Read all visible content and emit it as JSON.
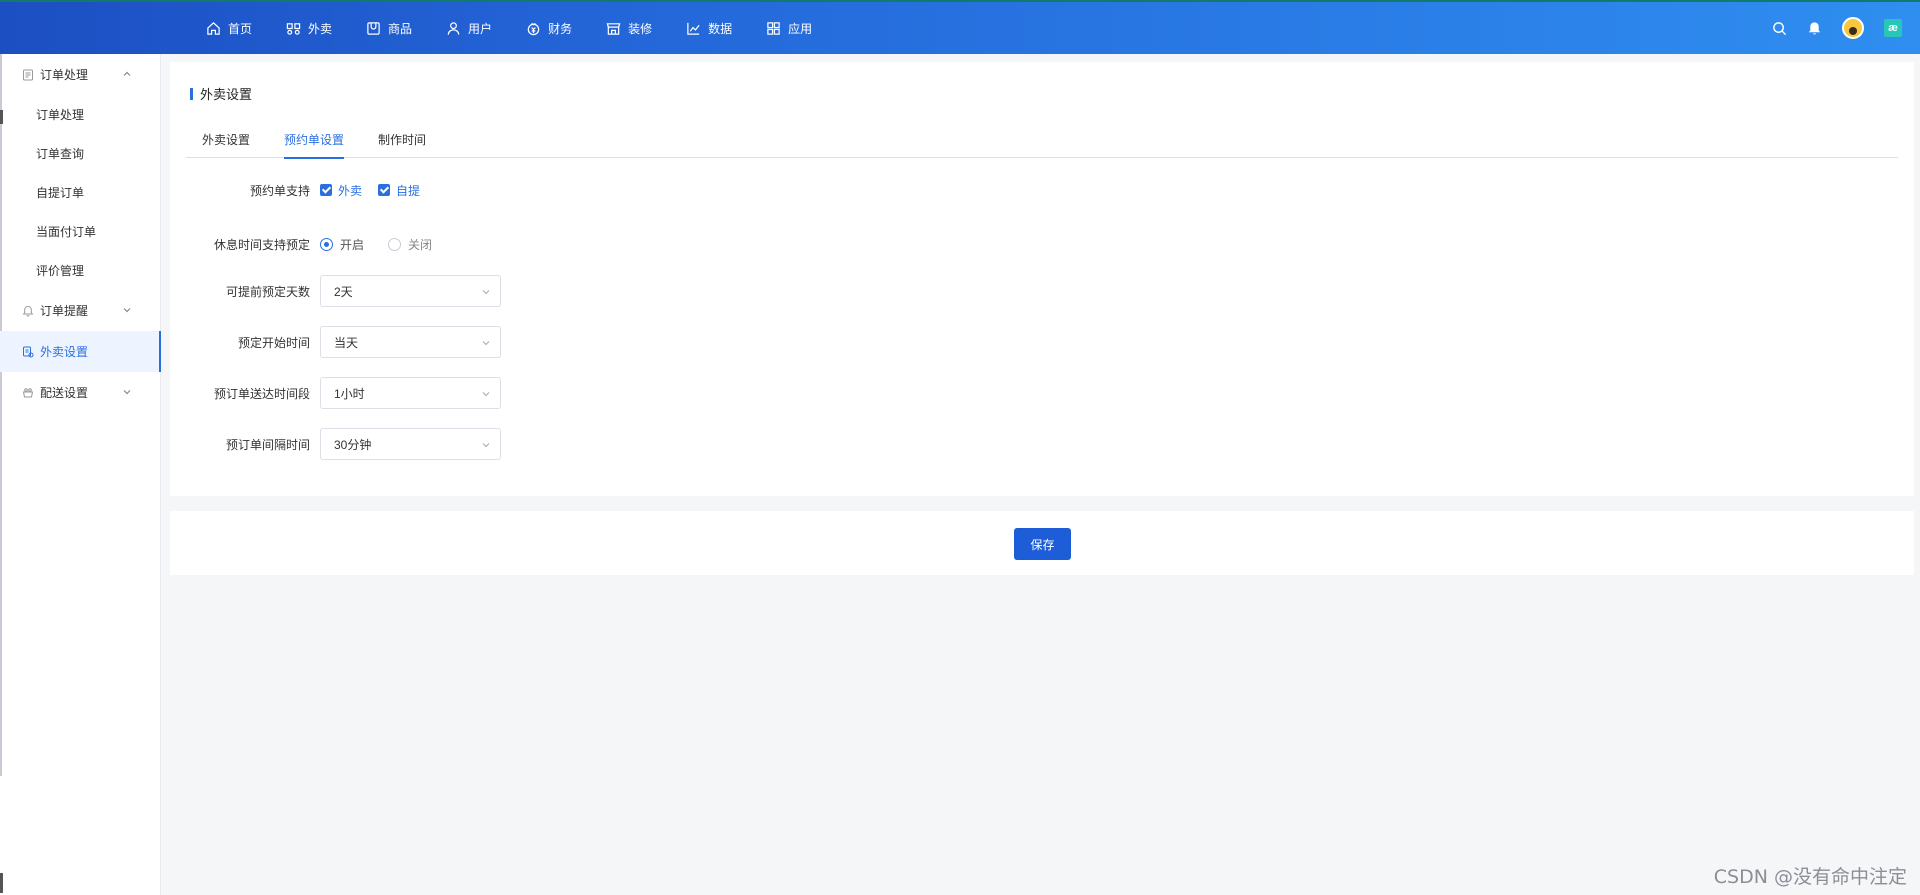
{
  "topnav": {
    "items": [
      {
        "label": "首页",
        "icon": "home-icon"
      },
      {
        "label": "外卖",
        "icon": "delivery-icon"
      },
      {
        "label": "商品",
        "icon": "goods-icon"
      },
      {
        "label": "用户",
        "icon": "user-icon"
      },
      {
        "label": "财务",
        "icon": "finance-icon"
      },
      {
        "label": "装修",
        "icon": "store-icon"
      },
      {
        "label": "数据",
        "icon": "chart-icon"
      },
      {
        "label": "应用",
        "icon": "apps-icon"
      }
    ],
    "app_badge": "æ"
  },
  "sidebar": {
    "order_group": {
      "label": "订单处理",
      "icon": "order-icon"
    },
    "order_items": [
      "订单处理",
      "订单查询",
      "自提订单",
      "当面付订单",
      "评价管理"
    ],
    "reminder_group": {
      "label": "订单提醒",
      "icon": "bell-icon"
    },
    "delivery_settings_group": {
      "label": "外卖设置",
      "icon": "settings-doc-icon"
    },
    "dispatch_group": {
      "label": "配送设置",
      "icon": "dispatch-icon"
    }
  },
  "main": {
    "title": "外卖设置",
    "tabs": [
      "外卖设置",
      "预约单设置",
      "制作时间"
    ],
    "active_tab": 1,
    "form": {
      "support_label": "预约单支持",
      "support_options": [
        "外卖",
        "自提"
      ],
      "rest_label": "休息时间支持预定",
      "rest_on": "开启",
      "rest_off": "关闭",
      "advance_days_label": "可提前预定天数",
      "advance_days_value": "2天",
      "start_time_label": "预定开始时间",
      "start_time_value": "当天",
      "delivery_slot_label": "预订单送达时间段",
      "delivery_slot_value": "1小时",
      "interval_label": "预订单间隔时间",
      "interval_value": "30分钟"
    }
  },
  "footer": {
    "save_label": "保存"
  },
  "watermark": "CSDN @没有命中注定",
  "colors": {
    "accent": "#2a6fe0",
    "topbar_start": "#1c4fc2",
    "topbar_end": "#2f8ef0",
    "save_button": "#1d5ed8"
  }
}
